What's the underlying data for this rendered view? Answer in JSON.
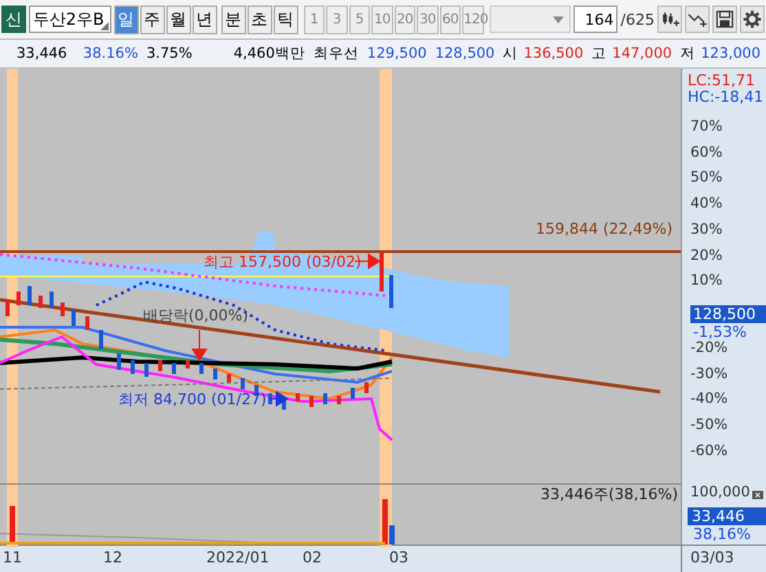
{
  "stock": {
    "badge": "신",
    "name": "두산2우B"
  },
  "period_tabs": [
    {
      "label": "일",
      "selected": true
    },
    {
      "label": "주",
      "selected": false
    },
    {
      "label": "월",
      "selected": false
    },
    {
      "label": "년",
      "selected": false
    },
    {
      "label": "분",
      "selected": false
    },
    {
      "label": "초",
      "selected": false
    },
    {
      "label": "틱",
      "selected": false
    }
  ],
  "interval_buttons": [
    "1",
    "3",
    "5",
    "10",
    "20",
    "30",
    "60",
    "120"
  ],
  "count": {
    "value": "164",
    "total": "/625"
  },
  "quote": [
    {
      "text": "33,446",
      "color": "#000000"
    },
    {
      "text": "38.16%",
      "color": "#1f4fd6"
    },
    {
      "text": "3.75%",
      "color": "#000000"
    },
    {
      "text": "4,460백만",
      "color": "#000000"
    },
    {
      "text": "최우선",
      "color": "#000000"
    },
    {
      "text": "129,500",
      "color": "#1f4fd6"
    },
    {
      "text": "128,500",
      "color": "#1f4fd6"
    },
    {
      "text": "시",
      "color": "#000000"
    },
    {
      "text": "136,500",
      "color": "#e0201a"
    },
    {
      "text": "고",
      "color": "#000000"
    },
    {
      "text": "147,000",
      "color": "#e0201a"
    },
    {
      "text": "저",
      "color": "#000000"
    },
    {
      "text": "123,000",
      "color": "#1f4fd6"
    }
  ],
  "annotations": [
    {
      "kind": "resistance",
      "text": "159,844 (22,49%)"
    },
    {
      "kind": "high",
      "text": "최고 157,500 (03/02)"
    },
    {
      "kind": "event",
      "text": "배당락(0,00%)"
    },
    {
      "kind": "low",
      "text": "최저 84,700 (01/27)"
    },
    {
      "kind": "volume",
      "text": "33,446주(38,16%)"
    }
  ],
  "price_axis": {
    "lc": "LC:51,71",
    "hc": "HC:-18,41",
    "upper_ticks": [
      "70%",
      "60%",
      "50%",
      "40%",
      "30%",
      "20%",
      "10%"
    ],
    "lower_ticks": [
      "-20%",
      "-30%",
      "-40%",
      "-50%",
      "-60%"
    ],
    "current_price": "128,500",
    "current_change": "-1,53%"
  },
  "volume_axis": {
    "tick": "100,000",
    "current_volume": "33,446",
    "current_ratio": "38,16%"
  },
  "date_axis": {
    "labels": [
      "11",
      "12",
      "2022/01",
      "02",
      "03"
    ],
    "cursor_date": "03/03"
  }
}
